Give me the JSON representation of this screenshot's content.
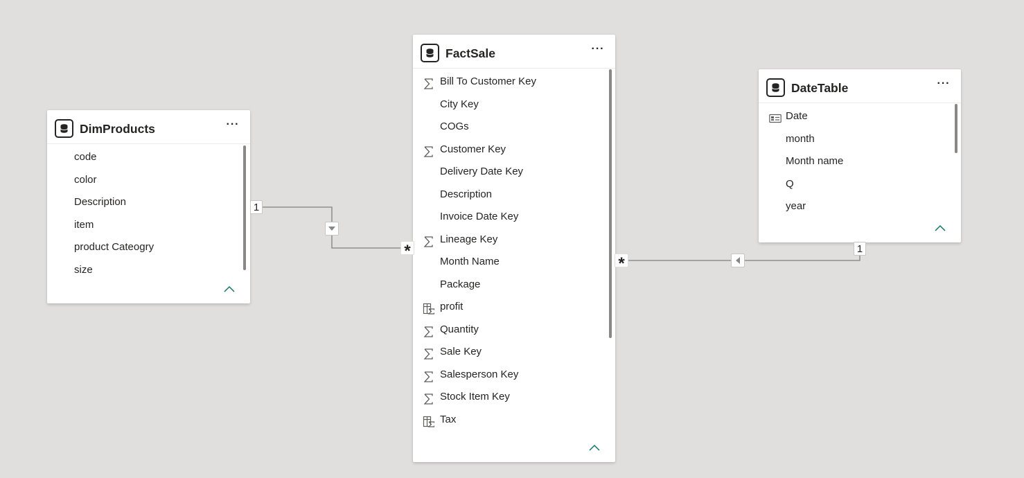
{
  "tables": {
    "dimproducts": {
      "title": "DimProducts",
      "more_label": "···",
      "fields": [
        {
          "name": "code",
          "icon": ""
        },
        {
          "name": "color",
          "icon": ""
        },
        {
          "name": "Description",
          "icon": ""
        },
        {
          "name": "item",
          "icon": ""
        },
        {
          "name": "product Cateogry",
          "icon": ""
        },
        {
          "name": "size",
          "icon": ""
        }
      ]
    },
    "factsale": {
      "title": "FactSale",
      "more_label": "···",
      "fields": [
        {
          "name": "Bill To Customer Key",
          "icon": "sigma-icon"
        },
        {
          "name": "City Key",
          "icon": ""
        },
        {
          "name": "COGs",
          "icon": ""
        },
        {
          "name": "Customer Key",
          "icon": "sigma-icon"
        },
        {
          "name": "Delivery Date Key",
          "icon": ""
        },
        {
          "name": "Description",
          "icon": ""
        },
        {
          "name": "Invoice Date Key",
          "icon": ""
        },
        {
          "name": "Lineage Key",
          "icon": "sigma-icon"
        },
        {
          "name": "Month Name",
          "icon": ""
        },
        {
          "name": "Package",
          "icon": ""
        },
        {
          "name": "profit",
          "icon": "calculated-column-icon"
        },
        {
          "name": "Quantity",
          "icon": "sigma-icon"
        },
        {
          "name": "Sale Key",
          "icon": "sigma-icon"
        },
        {
          "name": "Salesperson Key",
          "icon": "sigma-icon"
        },
        {
          "name": "Stock Item Key",
          "icon": "sigma-icon"
        },
        {
          "name": "Tax",
          "icon": "calculated-column-icon"
        }
      ]
    },
    "datetable": {
      "title": "DateTable",
      "more_label": "···",
      "fields": [
        {
          "name": "Date",
          "icon": "date-hierarchy-icon"
        },
        {
          "name": "month",
          "icon": ""
        },
        {
          "name": "Month name",
          "icon": ""
        },
        {
          "name": "Q",
          "icon": ""
        },
        {
          "name": "year",
          "icon": ""
        }
      ]
    }
  },
  "relationships": [
    {
      "from": "DimProducts",
      "to": "FactSale",
      "from_cardinality": "1",
      "to_cardinality": "*",
      "filter_direction": "down-icon"
    },
    {
      "from": "DateTable",
      "to": "FactSale",
      "from_cardinality": "1",
      "to_cardinality": "*",
      "filter_direction": "left-icon"
    }
  ],
  "colors": {
    "canvas": "#e1dfdd",
    "card": "#ffffff",
    "text": "#252423",
    "line": "#7f7f7f",
    "accent": "#117865"
  }
}
